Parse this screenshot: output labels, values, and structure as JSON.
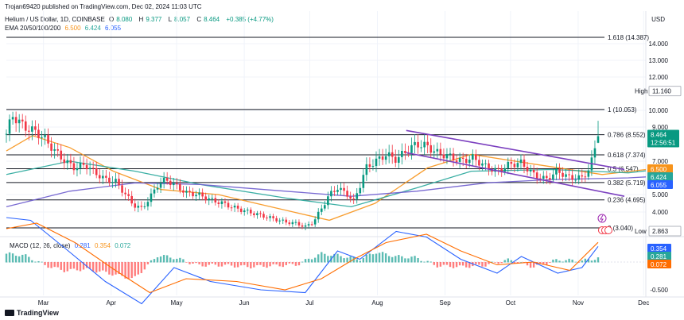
{
  "header": {
    "published": "Trojan69420 published on TradingView.com, Dec 02, 2024 11:03 UTC",
    "symbol": "Helium / US Dollar, 1D, COINBASE",
    "ohlc": {
      "o_label": "O",
      "o": "8.080",
      "h_label": "H",
      "h": "9.377",
      "l_label": "L",
      "l": "8.057",
      "c_label": "C",
      "c": "8.464",
      "chg": "+0.385 (+4.77%)"
    },
    "ema_label": "EMA 20/50/100/200",
    "ema_values": [
      "6.500",
      "6.424",
      "6.055"
    ]
  },
  "macd_header": {
    "label": "MACD (12, 26, close)",
    "values": [
      "0.281",
      "0.354",
      "0.072"
    ]
  },
  "currency": "USD",
  "branding": "TradingView",
  "colors": {
    "up": "#089981",
    "down": "#f23645",
    "ema20": "#f7931a",
    "ema50": "#26a69a",
    "ema200": "#6a5acd",
    "channel": "#7b3fbf",
    "macd": "#2962ff",
    "signal": "#ff6d00",
    "fib": "#131722"
  },
  "chart_data": [
    {
      "type": "candlestick",
      "title": "Helium / US Dollar, 1D, COINBASE",
      "x_range": [
        "2024-02-13",
        "2024-12-02"
      ],
      "x_ticks": [
        "Mar",
        "Apr",
        "May",
        "Jun",
        "Jul",
        "Aug",
        "Sep",
        "Oct",
        "Nov",
        "Dec"
      ],
      "y_ticks": [
        14.0,
        13.0,
        12.0,
        10.0,
        9.0,
        7.0,
        5.0,
        4.0
      ],
      "y_tick_labels": [
        "14.000",
        "13.000",
        "12.000",
        "10.000",
        "9.000",
        "7.000",
        "5.000",
        "4.000"
      ],
      "close_path": [
        [
          "2024-02-13",
          8.6
        ],
        [
          "2024-02-16",
          9.7
        ],
        [
          "2024-02-22",
          9.0
        ],
        [
          "2024-02-28",
          8.7
        ],
        [
          "2024-03-03",
          8.3
        ],
        [
          "2024-03-08",
          7.6
        ],
        [
          "2024-03-13",
          7.0
        ],
        [
          "2024-03-18",
          6.6
        ],
        [
          "2024-03-23",
          6.8
        ],
        [
          "2024-03-28",
          6.3
        ],
        [
          "2024-04-02",
          5.9
        ],
        [
          "2024-04-07",
          5.8
        ],
        [
          "2024-04-12",
          5.0
        ],
        [
          "2024-04-16",
          4.4
        ],
        [
          "2024-04-20",
          4.2
        ],
        [
          "2024-04-24",
          4.8
        ],
        [
          "2024-04-28",
          5.6
        ],
        [
          "2024-05-02",
          5.9
        ],
        [
          "2024-05-06",
          5.6
        ],
        [
          "2024-05-12",
          5.1
        ],
        [
          "2024-05-18",
          5.0
        ],
        [
          "2024-05-24",
          4.7
        ],
        [
          "2024-05-30",
          4.5
        ],
        [
          "2024-06-06",
          4.2
        ],
        [
          "2024-06-12",
          4.0
        ],
        [
          "2024-06-18",
          3.8
        ],
        [
          "2024-06-24",
          3.6
        ],
        [
          "2024-06-30",
          3.4
        ],
        [
          "2024-07-06",
          3.3
        ],
        [
          "2024-07-10",
          3.1
        ],
        [
          "2024-07-14",
          3.4
        ],
        [
          "2024-07-18",
          4.2
        ],
        [
          "2024-07-22",
          5.0
        ],
        [
          "2024-07-26",
          5.4
        ],
        [
          "2024-07-31",
          5.0
        ],
        [
          "2024-08-03",
          4.6
        ],
        [
          "2024-08-06",
          5.5
        ],
        [
          "2024-08-09",
          6.6
        ],
        [
          "2024-08-14",
          7.0
        ],
        [
          "2024-08-19",
          7.4
        ],
        [
          "2024-08-24",
          7.1
        ],
        [
          "2024-08-29",
          7.6
        ],
        [
          "2024-09-03",
          8.0
        ],
        [
          "2024-09-08",
          7.9
        ],
        [
          "2024-09-13",
          7.5
        ],
        [
          "2024-09-19",
          7.3
        ],
        [
          "2024-09-25",
          7.0
        ],
        [
          "2024-10-01",
          7.2
        ],
        [
          "2024-10-07",
          6.7
        ],
        [
          "2024-10-13",
          6.4
        ],
        [
          "2024-10-19",
          6.8
        ],
        [
          "2024-10-25",
          6.9
        ],
        [
          "2024-10-31",
          6.2
        ],
        [
          "2024-11-06",
          5.9
        ],
        [
          "2024-11-12",
          6.4
        ],
        [
          "2024-11-18",
          6.0
        ],
        [
          "2024-11-24",
          6.0
        ],
        [
          "2024-11-28",
          6.6
        ],
        [
          "2024-11-30",
          7.6
        ],
        [
          "2024-12-02",
          8.464
        ]
      ],
      "fib_levels": [
        {
          "label": "1.618 (14.387)",
          "value": 14.387
        },
        {
          "label": "1 (10.053)",
          "value": 10.053
        },
        {
          "label": "0.786 (8.552)",
          "value": 8.552
        },
        {
          "label": "0.618 (7.374)",
          "value": 7.374
        },
        {
          "label": "0.5 (6.547)",
          "value": 6.547
        },
        {
          "label": "0.382 (5.719)",
          "value": 5.719
        },
        {
          "label": "0.236 (4.695)",
          "value": 4.695
        },
        {
          "label": "0 (3.040)",
          "value": 3.04
        }
      ],
      "channel": {
        "upper": [
          [
            "2024-08-29",
            8.8
          ],
          [
            "2024-12-02",
            6.5
          ]
        ],
        "lower": [
          [
            "2024-08-29",
            7.5
          ],
          [
            "2024-12-02",
            4.9
          ]
        ]
      },
      "ema": [
        {
          "values": [
            [
              "2024-02-13",
              7.6
            ],
            [
              "2024-02-25",
              8.5
            ],
            [
              "2024-03-13",
              7.8
            ],
            [
              "2024-04-02",
              6.4
            ],
            [
              "2024-04-24",
              5.3
            ],
            [
              "2024-05-20",
              5.0
            ],
            [
              "2024-06-20",
              4.1
            ],
            [
              "2024-07-10",
              3.5
            ],
            [
              "2024-07-31",
              4.5
            ],
            [
              "2024-08-24",
              6.6
            ],
            [
              "2024-09-13",
              7.4
            ],
            [
              "2024-10-13",
              6.8
            ],
            [
              "2024-11-12",
              6.2
            ],
            [
              "2024-12-02",
              6.5
            ]
          ]
        },
        {
          "values": [
            [
              "2024-02-13",
              6.2
            ],
            [
              "2024-03-13",
              7.0
            ],
            [
              "2024-04-12",
              6.4
            ],
            [
              "2024-05-12",
              5.6
            ],
            [
              "2024-06-20",
              4.8
            ],
            [
              "2024-07-20",
              4.3
            ],
            [
              "2024-08-19",
              5.4
            ],
            [
              "2024-09-13",
              6.4
            ],
            [
              "2024-10-20",
              6.5
            ],
            [
              "2024-11-24",
              6.3
            ],
            [
              "2024-12-02",
              6.424
            ]
          ]
        },
        {
          "values": [
            [
              "2024-02-13",
              4.3
            ],
            [
              "2024-03-13",
              5.2
            ],
            [
              "2024-04-12",
              5.7
            ],
            [
              "2024-05-12",
              5.6
            ],
            [
              "2024-06-20",
              5.2
            ],
            [
              "2024-07-20",
              4.9
            ],
            [
              "2024-08-19",
              5.2
            ],
            [
              "2024-09-20",
              5.7
            ],
            [
              "2024-10-20",
              5.9
            ],
            [
              "2024-11-24",
              6.0
            ],
            [
              "2024-12-02",
              6.055
            ]
          ]
        }
      ],
      "price_labels": [
        {
          "text": "High",
          "value_text": "11.160",
          "value": 11.16
        },
        {
          "text": "8.464",
          "sub": "12:56:51",
          "value": 8.464
        },
        {
          "text": "6.500",
          "value": 6.5
        },
        {
          "text": "6.424",
          "value": 6.424
        },
        {
          "text": "6.055",
          "value": 6.055
        },
        {
          "text": "Low",
          "value_text": "2.863",
          "value": 2.863
        }
      ]
    },
    {
      "type": "bar",
      "title": "MACD (12, 26, close)",
      "y_ticks": [
        0,
        -0.5
      ],
      "y_tick_labels": [
        "0.500",
        "-0.500"
      ],
      "histogram": [
        [
          "2024-02-13",
          0.15
        ],
        [
          "2024-02-22",
          0.12
        ],
        [
          "2024-03-03",
          -0.05
        ],
        [
          "2024-03-13",
          -0.15
        ],
        [
          "2024-03-23",
          -0.12
        ],
        [
          "2024-04-02",
          -0.18
        ],
        [
          "2024-04-16",
          -0.3
        ],
        [
          "2024-04-28",
          0.12
        ],
        [
          "2024-05-06",
          0.08
        ],
        [
          "2024-05-18",
          -0.05
        ],
        [
          "2024-05-30",
          -0.05
        ],
        [
          "2024-06-12",
          -0.08
        ],
        [
          "2024-06-24",
          -0.06
        ],
        [
          "2024-07-06",
          -0.04
        ],
        [
          "2024-07-18",
          0.15
        ],
        [
          "2024-07-26",
          0.12
        ],
        [
          "2024-08-06",
          0.05
        ],
        [
          "2024-08-14",
          0.18
        ],
        [
          "2024-08-24",
          0.1
        ],
        [
          "2024-09-03",
          0.08
        ],
        [
          "2024-09-13",
          -0.06
        ],
        [
          "2024-09-25",
          -0.08
        ],
        [
          "2024-10-07",
          -0.05
        ],
        [
          "2024-10-19",
          0.04
        ],
        [
          "2024-10-31",
          -0.08
        ],
        [
          "2024-11-12",
          0.04
        ],
        [
          "2024-11-24",
          0.02
        ],
        [
          "2024-12-02",
          0.072
        ]
      ],
      "macd_line": [
        [
          "2024-02-13",
          0.8
        ],
        [
          "2024-02-25",
          0.75
        ],
        [
          "2024-03-13",
          0.25
        ],
        [
          "2024-04-02",
          -0.35
        ],
        [
          "2024-04-20",
          -0.75
        ],
        [
          "2024-05-06",
          -0.1
        ],
        [
          "2024-05-24",
          -0.35
        ],
        [
          "2024-06-18",
          -0.5
        ],
        [
          "2024-07-10",
          -0.55
        ],
        [
          "2024-07-26",
          0.2
        ],
        [
          "2024-08-06",
          0.05
        ],
        [
          "2024-08-24",
          0.55
        ],
        [
          "2024-09-08",
          0.45
        ],
        [
          "2024-09-25",
          0.05
        ],
        [
          "2024-10-13",
          -0.2
        ],
        [
          "2024-10-25",
          0.1
        ],
        [
          "2024-11-12",
          -0.2
        ],
        [
          "2024-11-24",
          -0.1
        ],
        [
          "2024-12-02",
          0.281
        ]
      ],
      "signal_line": [
        [
          "2024-02-13",
          0.6
        ],
        [
          "2024-02-28",
          0.7
        ],
        [
          "2024-03-18",
          0.35
        ],
        [
          "2024-04-07",
          -0.15
        ],
        [
          "2024-04-24",
          -0.55
        ],
        [
          "2024-05-12",
          -0.3
        ],
        [
          "2024-06-06",
          -0.35
        ],
        [
          "2024-06-30",
          -0.5
        ],
        [
          "2024-07-18",
          -0.3
        ],
        [
          "2024-08-03",
          0.05
        ],
        [
          "2024-08-19",
          0.35
        ],
        [
          "2024-09-08",
          0.5
        ],
        [
          "2024-09-25",
          0.2
        ],
        [
          "2024-10-13",
          -0.05
        ],
        [
          "2024-10-31",
          0.0
        ],
        [
          "2024-11-18",
          -0.15
        ],
        [
          "2024-12-02",
          0.354
        ]
      ]
    }
  ]
}
